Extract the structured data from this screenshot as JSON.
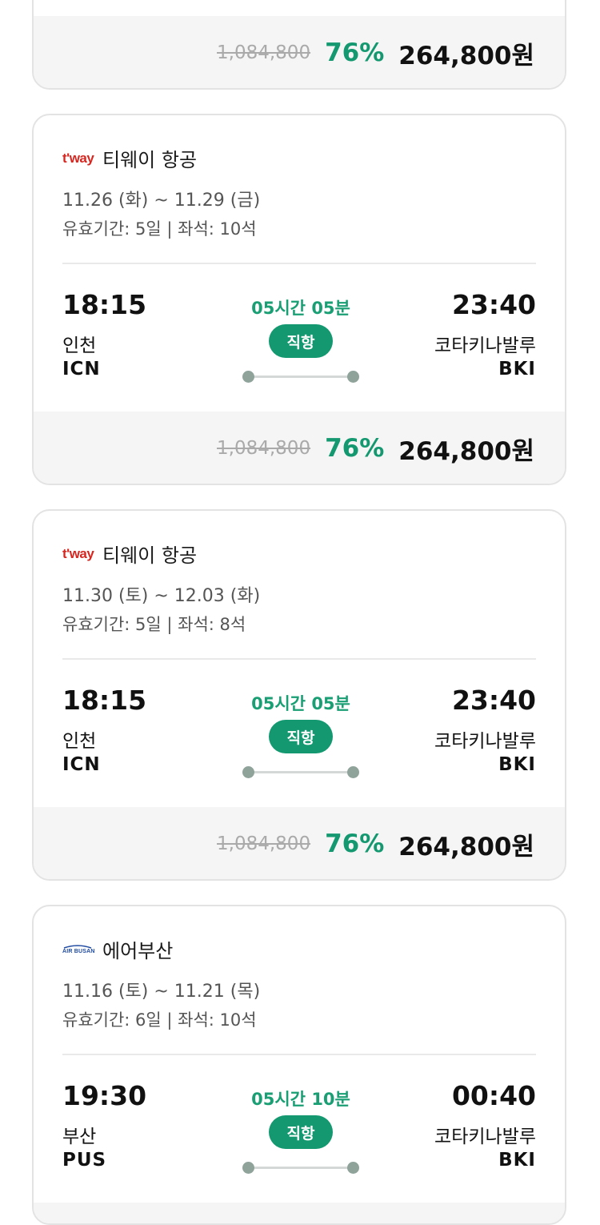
{
  "top_price_bar": {
    "original_price": "1,084,800",
    "discount": "76%",
    "final_price": "264,800원"
  },
  "cards": [
    {
      "airline": "티웨이 항공",
      "logo_text": "t'way",
      "dates": "11.26 (화) ~ 11.29 (금)",
      "validity": "유효기간: 5일 | 좌석: 10석",
      "departure": {
        "time": "18:15",
        "city": "인천",
        "code": "ICN"
      },
      "arrival": {
        "time": "23:40",
        "city": "코타키나발루",
        "code": "BKI"
      },
      "duration": "05시간 05분",
      "flight_type": "직항",
      "original_price": "1,084,800",
      "discount": "76%",
      "final_price": "264,800원"
    },
    {
      "airline": "티웨이 항공",
      "logo_text": "t'way",
      "dates": "11.30 (토) ~ 12.03 (화)",
      "validity": "유효기간: 5일 | 좌석: 8석",
      "departure": {
        "time": "18:15",
        "city": "인천",
        "code": "ICN"
      },
      "arrival": {
        "time": "23:40",
        "city": "코타키나발루",
        "code": "BKI"
      },
      "duration": "05시간 05분",
      "flight_type": "직항",
      "original_price": "1,084,800",
      "discount": "76%",
      "final_price": "264,800원"
    },
    {
      "airline": "에어부산",
      "logo_text": "AIR BUSAN",
      "dates": "11.16 (토) ~ 11.21 (목)",
      "validity": "유효기간: 6일 | 좌석: 10석",
      "departure": {
        "time": "19:30",
        "city": "부산",
        "code": "PUS"
      },
      "arrival": {
        "time": "00:40",
        "city": "코타키나발루",
        "code": "BKI"
      },
      "duration": "05시간 10분",
      "flight_type": "직항"
    }
  ],
  "colors": {
    "accent_green": "#13986f",
    "tway_red": "#d7261f",
    "airbusan_blue": "#1f4aa0"
  }
}
